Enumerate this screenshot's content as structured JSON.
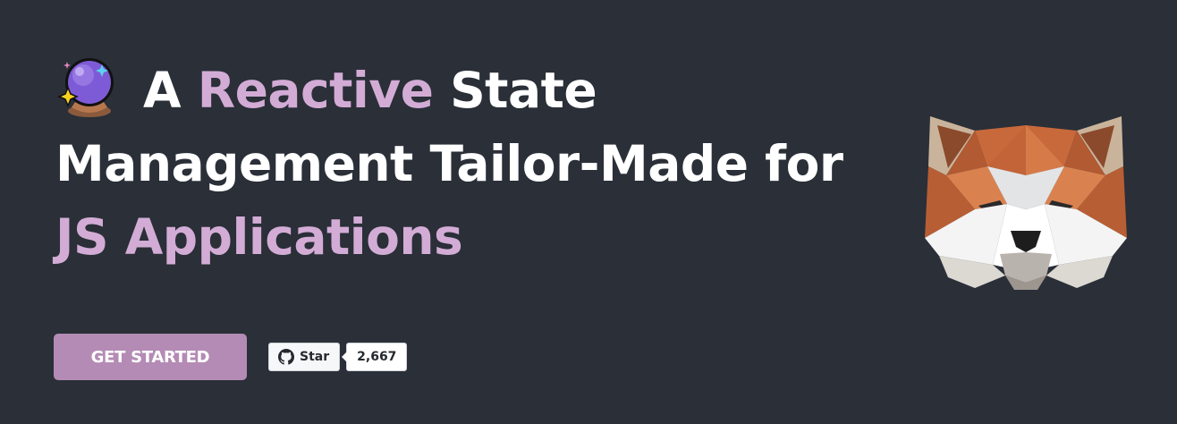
{
  "hero": {
    "headline_part1": "A",
    "headline_accent1": "Reactive",
    "headline_part2": "State Management Tailor-Made for",
    "headline_accent2": "JS Applications",
    "crystal_ball_icon": "crystal-ball-icon"
  },
  "cta": {
    "get_started_label": "GET STARTED"
  },
  "github": {
    "star_label": "Star",
    "star_count": "2,667",
    "icon": "github-icon"
  },
  "mascot": {
    "icon": "akita-dog-logo"
  },
  "colors": {
    "background": "#2a2f38",
    "accent": "#d3acd6",
    "button": "#b48bb5",
    "text": "#ffffff"
  }
}
